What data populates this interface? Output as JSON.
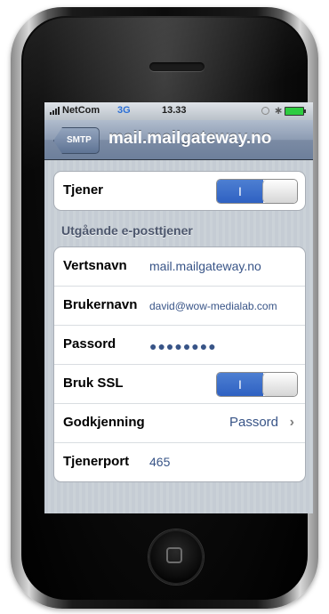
{
  "status_bar": {
    "carrier": "NetCom",
    "network": "3G",
    "time": "13.33"
  },
  "nav": {
    "back_label": "SMTP",
    "title": "mail.mailgateway.no"
  },
  "server_group": {
    "label": "Tjener",
    "toggle_state": "on",
    "toggle_on_label": "I"
  },
  "section_header": "Utgående e-posttjener",
  "settings": {
    "hostname_label": "Vertsnavn",
    "hostname_value": "mail.mailgateway.no",
    "username_label": "Brukernavn",
    "username_value": "david@wow-medialab.com",
    "password_label": "Passord",
    "password_value": "●●●●●●●●",
    "ssl_label": "Bruk SSL",
    "ssl_state": "on",
    "ssl_on_label": "I",
    "auth_label": "Godkjenning",
    "auth_value": "Passord",
    "port_label": "Tjenerport",
    "port_value": "465"
  },
  "colors": {
    "nav_bar": "#7b8ba4",
    "value_text": "#385487",
    "toggle_on": "#2f61c2",
    "background_stripes": "#c5ccd4"
  },
  "icons": [
    "signal-icon",
    "lock-icon",
    "bluetooth-icon",
    "battery-icon",
    "chevron-right-icon",
    "home-button-icon"
  ]
}
